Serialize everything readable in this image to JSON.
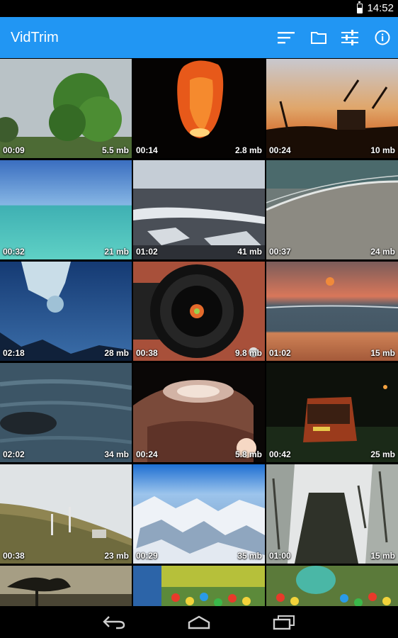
{
  "status_bar": {
    "time": "14:52"
  },
  "app_bar": {
    "title": "VidTrim",
    "actions": [
      {
        "name": "sort-icon"
      },
      {
        "name": "folder-icon"
      },
      {
        "name": "filter-settings-icon"
      },
      {
        "name": "info-icon"
      }
    ],
    "color": "#2196f3"
  },
  "videos": [
    {
      "duration": "00:09",
      "size": "5.5 mb",
      "scene": "green tree"
    },
    {
      "duration": "00:14",
      "size": "2.8 mb",
      "scene": "sky lantern"
    },
    {
      "duration": "00:24",
      "size": "10 mb",
      "scene": "sunset grass"
    },
    {
      "duration": "00:32",
      "size": "21 mb",
      "scene": "turquoise sea"
    },
    {
      "duration": "01:02",
      "size": "41 mb",
      "scene": "snowy town"
    },
    {
      "duration": "00:37",
      "size": "24 mb",
      "scene": "beach waves"
    },
    {
      "duration": "02:18",
      "size": "28 mb",
      "scene": "icicle"
    },
    {
      "duration": "00:38",
      "size": "9.8 mb",
      "scene": "camera lens"
    },
    {
      "duration": "01:02",
      "size": "15 mb",
      "scene": "sunset beach"
    },
    {
      "duration": "02:02",
      "size": "34 mb",
      "scene": "river rock"
    },
    {
      "duration": "00:24",
      "size": "5.8 mb",
      "scene": "lamp closeup"
    },
    {
      "duration": "00:42",
      "size": "25 mb",
      "scene": "van at night"
    },
    {
      "duration": "00:38",
      "size": "23 mb",
      "scene": "hillside"
    },
    {
      "duration": "00:29",
      "size": "35 mb",
      "scene": "snowy mountains"
    },
    {
      "duration": "01:00",
      "size": "15 mb",
      "scene": "snowy forest"
    },
    {
      "duration": "",
      "size": "",
      "scene": "tree silhouette"
    },
    {
      "duration": "",
      "size": "",
      "scene": "ball pit"
    },
    {
      "duration": "",
      "size": "",
      "scene": "ball pit toy"
    }
  ],
  "nav_bar": {
    "buttons": [
      {
        "name": "back-button"
      },
      {
        "name": "home-button"
      },
      {
        "name": "recents-button"
      }
    ]
  }
}
